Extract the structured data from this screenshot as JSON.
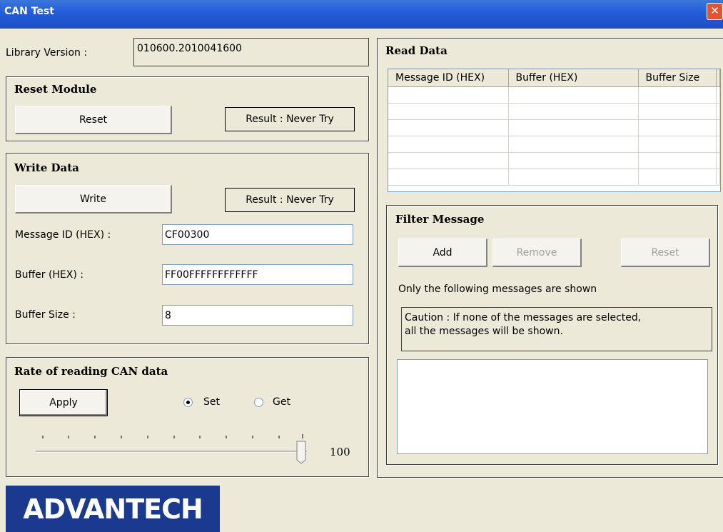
{
  "window": {
    "title": "CAN Test",
    "close_glyph": "✕"
  },
  "library": {
    "label": "Library Version :",
    "value": "010600.2010041600"
  },
  "reset_module": {
    "title": "Reset Module",
    "button": "Reset",
    "result": "Result : Never Try"
  },
  "write_data": {
    "title": "Write Data",
    "button": "Write",
    "result": "Result : Never Try",
    "message_id_label": "Message ID (HEX) :",
    "message_id_value": "CF00300",
    "buffer_label": "Buffer (HEX) :",
    "buffer_value": "FF00FFFFFFFFFFFF",
    "buffer_size_label": "Buffer Size :",
    "buffer_size_value": "8"
  },
  "rate": {
    "title": "Rate of reading CAN data",
    "apply_button": "Apply",
    "set_label": "Set",
    "get_label": "Get",
    "selected": "Set",
    "slider_value": "100"
  },
  "read_data": {
    "title": "Read Data",
    "columns": [
      "Message ID (HEX)",
      "Buffer (HEX)",
      "Buffer Size"
    ]
  },
  "filter": {
    "title": "Filter Message",
    "add_button": "Add",
    "remove_button": "Remove",
    "reset_button": "Reset",
    "note": "Only the following messages are shown",
    "caution_line1": "Caution : If none of the messages are selected,",
    "caution_line2": "all the messages will be shown."
  },
  "logo": {
    "text": "ADVANTECH"
  },
  "colors": {
    "titlebar": "#245edc",
    "face": "#ece9d8",
    "logo_bg": "#1a3a8f"
  }
}
